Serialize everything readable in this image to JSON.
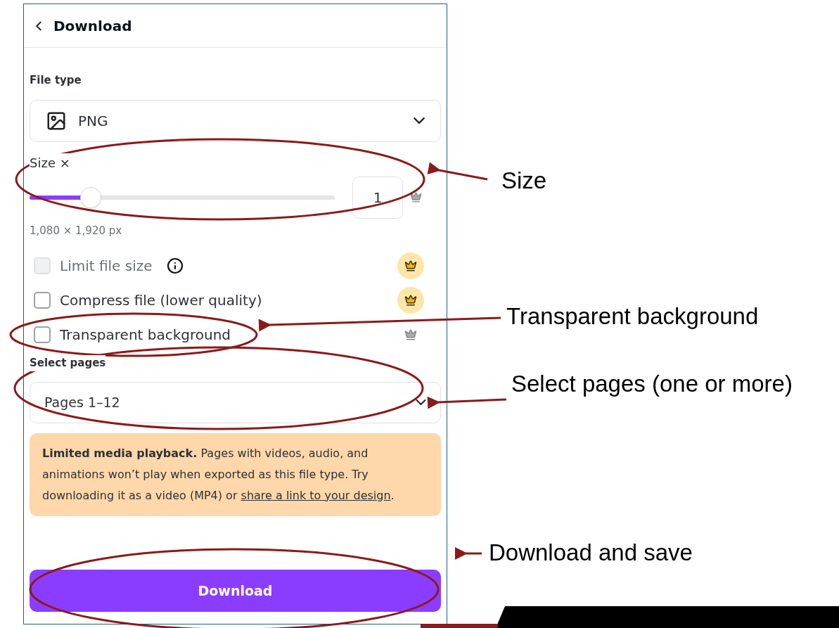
{
  "panel": {
    "title": "Download",
    "file_type": {
      "label": "File type",
      "value": "PNG"
    },
    "size": {
      "label": "Size ×",
      "level": 0.2,
      "value": "1",
      "dimensions": "1,080 × 1,920 px"
    },
    "options": [
      {
        "label": "Limit file size",
        "checked": false,
        "disabled": true,
        "info": true,
        "kind": "circled"
      },
      {
        "label": "Compress file (lower quality)",
        "checked": false,
        "disabled": false,
        "info": false,
        "kind": "circled"
      },
      {
        "label": "Transparent background",
        "checked": false,
        "disabled": false,
        "info": false,
        "kind": "plain"
      }
    ],
    "pages": {
      "label": "Select pages",
      "value": "Pages 1–12"
    },
    "notice": {
      "text": "**Limited media playback.** Pages with videos, audio, and animations won’t play when exported as this file type. Try downloading it as a video (MP4) or",
      "link": "share a link to your design",
      "after": "."
    },
    "button": "Download"
  },
  "annotations": [
    {
      "label": "Size"
    },
    {
      "label": "Transparent background"
    },
    {
      "label": "Select pages (one or more)"
    },
    {
      "label": "Download and save"
    }
  ]
}
